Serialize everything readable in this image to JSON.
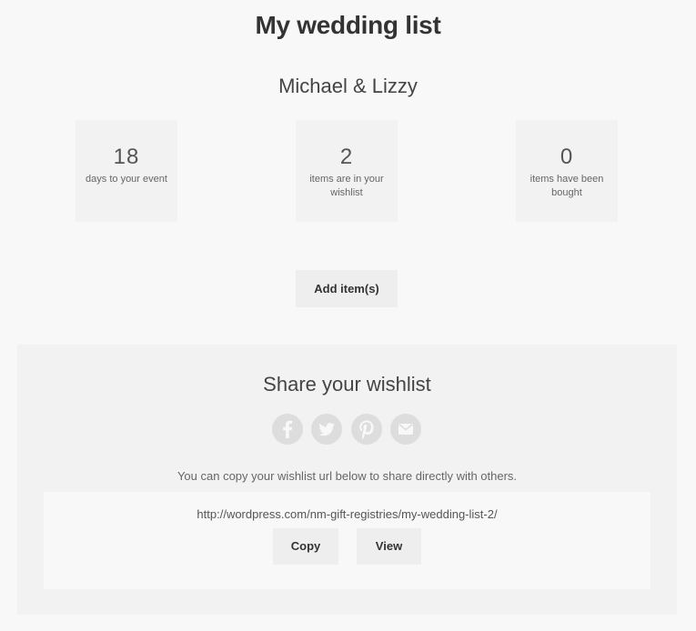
{
  "page": {
    "title": "My wedding list",
    "couple": "Michael & Lizzy"
  },
  "stats": [
    {
      "value": "18",
      "label": "days to your event"
    },
    {
      "value": "2",
      "label": "items are in your wishlist"
    },
    {
      "value": "0",
      "label": "items have been bought"
    }
  ],
  "actions": {
    "add_label": "Add item(s)"
  },
  "share": {
    "title": "Share your wishlist",
    "icons": [
      "facebook-icon",
      "twitter-icon",
      "pinterest-icon",
      "email-icon"
    ],
    "note": "You can copy your wishlist url below to share directly with others.",
    "url": "http://wordpress.com/nm-gift-registries/my-wedding-list-2/",
    "copy_label": "Copy",
    "view_label": "View"
  },
  "colors": {
    "background": "#f8f8f8",
    "tile": "#f2f2f2",
    "button": "#eeeeee",
    "social_icon_bg": "#dddddd",
    "social_icon_fg": "#f8f8f8"
  }
}
